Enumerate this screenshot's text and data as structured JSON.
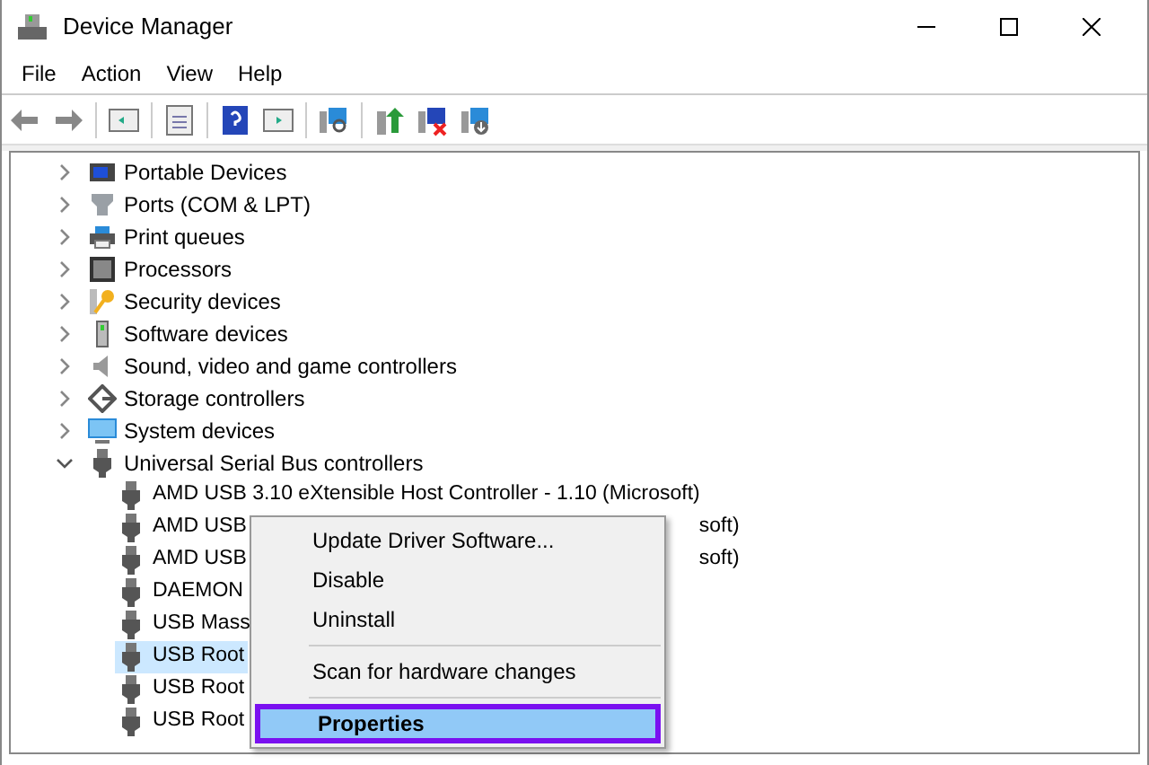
{
  "window": {
    "title": "Device Manager"
  },
  "menu_bar": [
    "File",
    "Action",
    "View",
    "Help"
  ],
  "tree": [
    {
      "label": "Portable Devices",
      "expanded": false
    },
    {
      "label": "Ports (COM & LPT)",
      "expanded": false
    },
    {
      "label": "Print queues",
      "expanded": false
    },
    {
      "label": "Processors",
      "expanded": false
    },
    {
      "label": "Security devices",
      "expanded": false
    },
    {
      "label": "Software devices",
      "expanded": false
    },
    {
      "label": "Sound, video and game controllers",
      "expanded": false
    },
    {
      "label": "Storage controllers",
      "expanded": false
    },
    {
      "label": "System devices",
      "expanded": false
    },
    {
      "label": "Universal Serial Bus controllers",
      "expanded": true,
      "children": [
        {
          "label": "AMD USB 3.10 eXtensible Host Controller - 1.10 (Microsoft)",
          "selected": false
        },
        {
          "label": "AMD USB",
          "tail": "soft)",
          "selected": false
        },
        {
          "label": "AMD USB",
          "tail": "soft)",
          "selected": false
        },
        {
          "label": "DAEMON",
          "selected": false
        },
        {
          "label": "USB Mass",
          "selected": false
        },
        {
          "label": "USB Root",
          "selected": true
        },
        {
          "label": "USB Root",
          "selected": false
        },
        {
          "label": "USB Root",
          "selected": false
        }
      ]
    }
  ],
  "context_menu": [
    {
      "kind": "item",
      "label": "Update Driver Software...",
      "selected": false
    },
    {
      "kind": "item",
      "label": "Disable",
      "selected": false
    },
    {
      "kind": "item",
      "label": "Uninstall",
      "selected": false
    },
    {
      "kind": "separator"
    },
    {
      "kind": "item",
      "label": "Scan for hardware changes",
      "selected": false
    },
    {
      "kind": "separator"
    },
    {
      "kind": "item",
      "label": "Properties",
      "selected": true
    }
  ]
}
